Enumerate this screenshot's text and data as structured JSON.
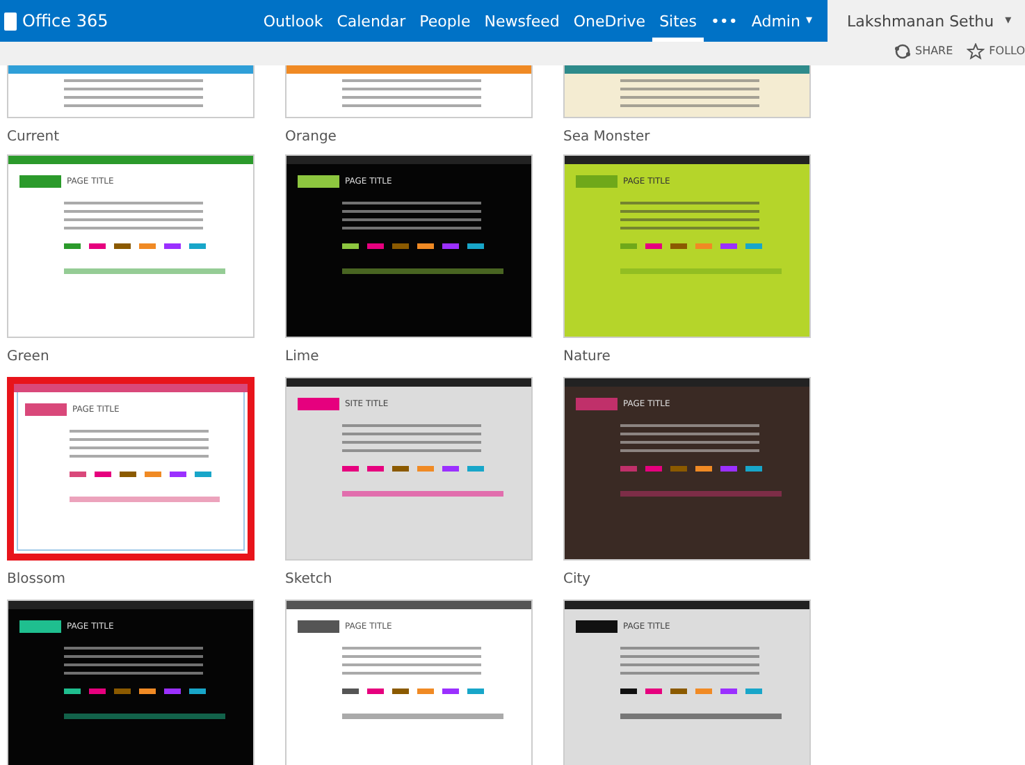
{
  "top_bar": {
    "brand": "Office 365",
    "nav": [
      {
        "label": "Outlook",
        "selected": false
      },
      {
        "label": "Calendar",
        "selected": false
      },
      {
        "label": "People",
        "selected": false
      },
      {
        "label": "Newsfeed",
        "selected": false
      },
      {
        "label": "OneDrive",
        "selected": false
      },
      {
        "label": "Sites",
        "selected": true
      }
    ],
    "more": "•••",
    "admin": "Admin",
    "admin_caret": "▾",
    "user": "Lakshmanan Sethu",
    "user_caret": "▾"
  },
  "actions": [
    {
      "kind": "share",
      "label": "SHARE"
    },
    {
      "kind": "follow",
      "label": "FOLLO"
    }
  ],
  "themes": [
    {
      "name": "Current",
      "kind": "light",
      "color": "#2f9fd8",
      "selected": false
    },
    {
      "name": "Orange",
      "kind": "light",
      "color": "#f08a24",
      "selected": false
    },
    {
      "name": "Sea Monster",
      "kind": "cream",
      "color": "#2e8b8b",
      "selected": false
    },
    {
      "name": "Green",
      "kind": "light",
      "color": "#2b9a2b",
      "selected": false,
      "title": "PAGE TITLE"
    },
    {
      "name": "Lime",
      "kind": "dark",
      "color": "#8dc63f",
      "selected": false,
      "title": "PAGE TITLE"
    },
    {
      "name": "Nature",
      "kind": "leaf",
      "color": "#6fa81a",
      "selected": false,
      "title": "PAGE TITLE"
    },
    {
      "name": "Blossom",
      "kind": "light",
      "color": "#d9487a",
      "selected": true,
      "title": "PAGE TITLE"
    },
    {
      "name": "Sketch",
      "kind": "grey",
      "color": "#e6007e",
      "selected": false,
      "title": "SITE TITLE"
    },
    {
      "name": "City",
      "kind": "night",
      "color": "#c0306a",
      "selected": false,
      "title": "PAGE TITLE"
    },
    {
      "kind": "dark",
      "color": "#1fbf8f",
      "selected": false,
      "title": "PAGE TITLE"
    },
    {
      "kind": "light",
      "color": "#555555",
      "selected": false,
      "title": "PAGE TITLE"
    },
    {
      "kind": "grey",
      "color": "#111111",
      "selected": false,
      "title": "PAGE TITLE"
    }
  ]
}
